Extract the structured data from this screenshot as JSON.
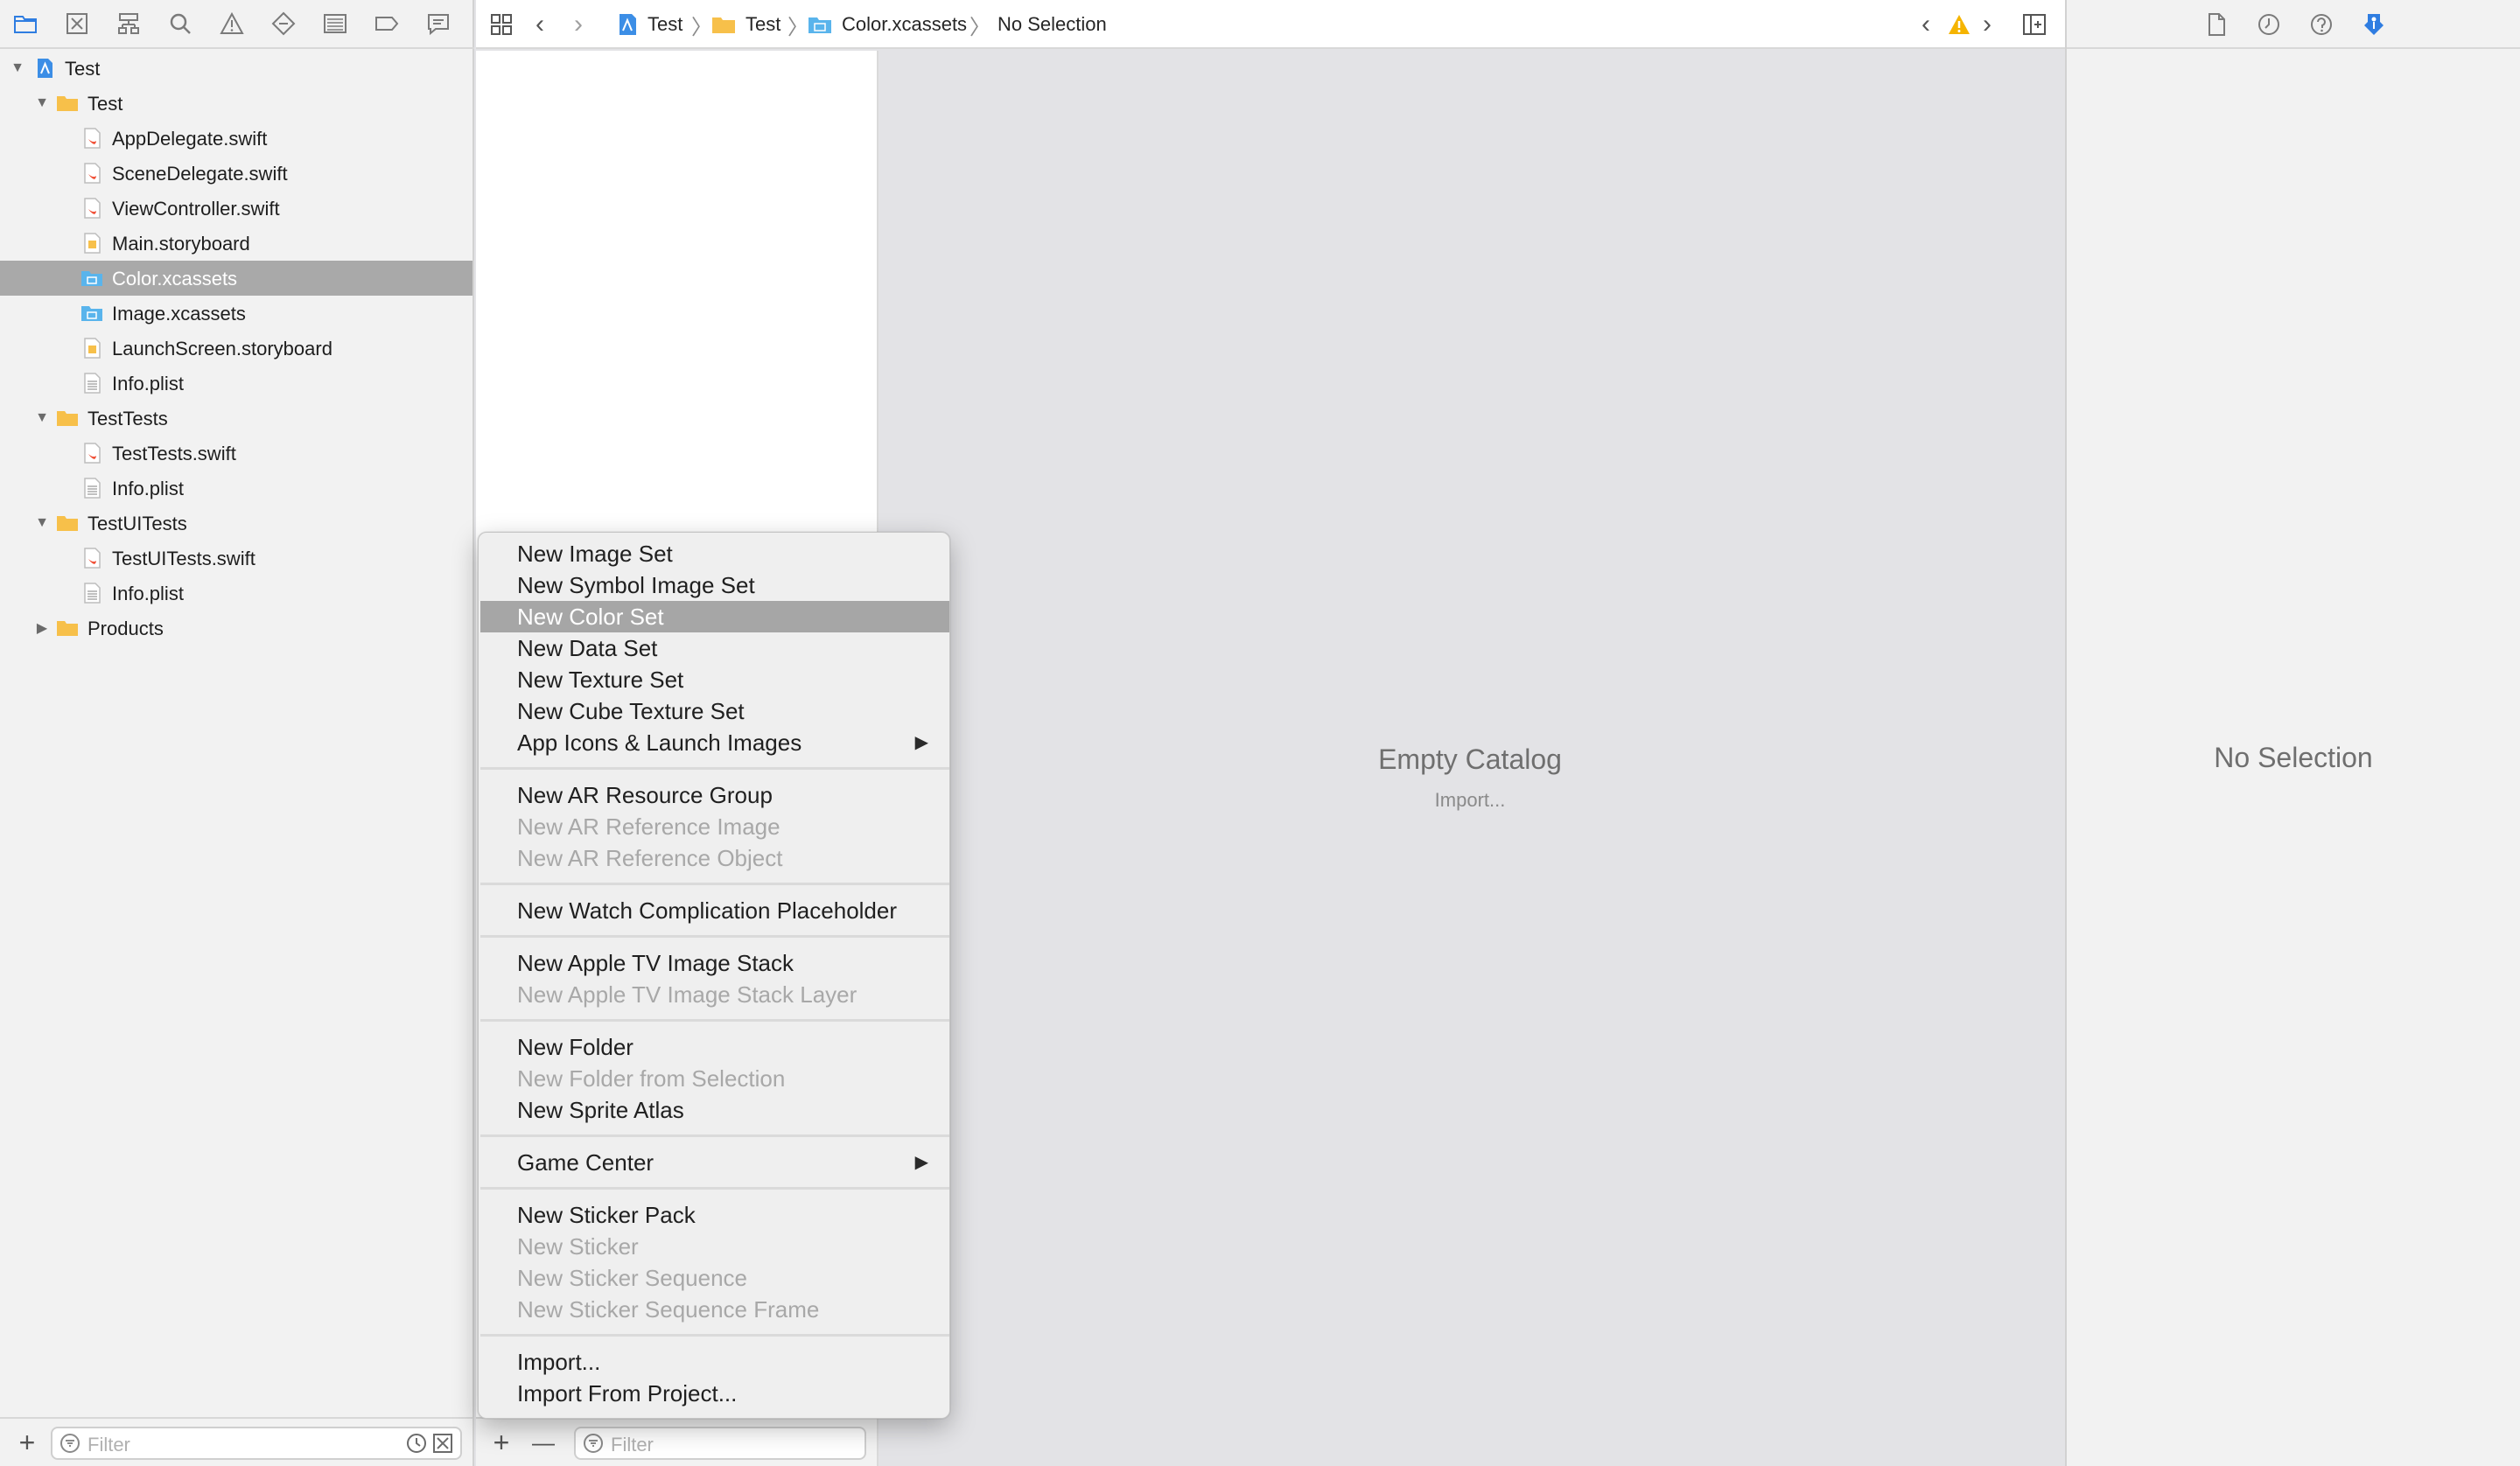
{
  "navigator": {
    "toolbar_icons": [
      "folder-icon",
      "source-control-icon",
      "hierarchy-icon",
      "search-icon",
      "warning-icon",
      "test-diamond-icon",
      "debug-icon",
      "breakpoint-icon",
      "report-icon"
    ],
    "tree": [
      {
        "label": "Test",
        "kind": "project",
        "depth": 0,
        "disclosure": "open"
      },
      {
        "label": "Test",
        "kind": "folder",
        "depth": 1,
        "disclosure": "open"
      },
      {
        "label": "AppDelegate.swift",
        "kind": "swift",
        "depth": 2
      },
      {
        "label": "SceneDelegate.swift",
        "kind": "swift",
        "depth": 2
      },
      {
        "label": "ViewController.swift",
        "kind": "swift",
        "depth": 2
      },
      {
        "label": "Main.storyboard",
        "kind": "storyboard",
        "depth": 2
      },
      {
        "label": "Color.xcassets",
        "kind": "xcassets",
        "depth": 2,
        "selected": true
      },
      {
        "label": "Image.xcassets",
        "kind": "xcassets",
        "depth": 2
      },
      {
        "label": "LaunchScreen.storyboard",
        "kind": "storyboard",
        "depth": 2
      },
      {
        "label": "Info.plist",
        "kind": "plist",
        "depth": 2
      },
      {
        "label": "TestTests",
        "kind": "folder",
        "depth": 1,
        "disclosure": "open"
      },
      {
        "label": "TestTests.swift",
        "kind": "swift",
        "depth": 2
      },
      {
        "label": "Info.plist",
        "kind": "plist",
        "depth": 2
      },
      {
        "label": "TestUITests",
        "kind": "folder",
        "depth": 1,
        "disclosure": "open"
      },
      {
        "label": "TestUITests.swift",
        "kind": "swift",
        "depth": 2
      },
      {
        "label": "Info.plist",
        "kind": "plist",
        "depth": 2
      },
      {
        "label": "Products",
        "kind": "folder",
        "depth": 1,
        "disclosure": "closed"
      }
    ],
    "filter_placeholder": "Filter"
  },
  "jumpbar": {
    "crumbs": [
      "Test",
      "Test",
      "Color.xcassets",
      "No Selection"
    ],
    "warning_color": "#f5b400"
  },
  "asset_list": {
    "filter_placeholder": "Filter",
    "add_label": "+",
    "remove_label": "—"
  },
  "canvas": {
    "empty_title": "Empty Catalog",
    "import_link": "Import..."
  },
  "inspector": {
    "icons": [
      "file-inspector-icon",
      "history-icon",
      "help-icon",
      "attributes-inspector-icon"
    ],
    "no_selection": "No Selection"
  },
  "context_menu": {
    "groups": [
      [
        {
          "label": "New Image Set",
          "enabled": true
        },
        {
          "label": "New Symbol Image Set",
          "enabled": true
        },
        {
          "label": "New Color Set",
          "enabled": true,
          "highlighted": true
        },
        {
          "label": "New Data Set",
          "enabled": true
        },
        {
          "label": "New Texture Set",
          "enabled": true
        },
        {
          "label": "New Cube Texture Set",
          "enabled": true
        },
        {
          "label": "App Icons & Launch Images",
          "enabled": true,
          "submenu": true
        }
      ],
      [
        {
          "label": "New AR Resource Group",
          "enabled": true
        },
        {
          "label": "New AR Reference Image",
          "enabled": false
        },
        {
          "label": "New AR Reference Object",
          "enabled": false
        }
      ],
      [
        {
          "label": "New Watch Complication Placeholder",
          "enabled": true
        }
      ],
      [
        {
          "label": "New Apple TV Image Stack",
          "enabled": true
        },
        {
          "label": "New Apple TV Image Stack Layer",
          "enabled": false
        }
      ],
      [
        {
          "label": "New Folder",
          "enabled": true
        },
        {
          "label": "New Folder from Selection",
          "enabled": false
        },
        {
          "label": "New Sprite Atlas",
          "enabled": true
        }
      ],
      [
        {
          "label": "Game Center",
          "enabled": true,
          "submenu": true
        }
      ],
      [
        {
          "label": "New Sticker Pack",
          "enabled": true
        },
        {
          "label": "New Sticker",
          "enabled": false
        },
        {
          "label": "New Sticker Sequence",
          "enabled": false
        },
        {
          "label": "New Sticker Sequence Frame",
          "enabled": false
        }
      ],
      [
        {
          "label": "Import...",
          "enabled": true
        },
        {
          "label": "Import From Project...",
          "enabled": true
        }
      ]
    ],
    "submenu_arrow": "▶"
  },
  "colors": {
    "folder": "#f7c04a",
    "selection": "#a9a9a9",
    "menu_highlight": "#a6a6a6",
    "swift": "#f05138",
    "xcassets": "#59b4ec"
  }
}
